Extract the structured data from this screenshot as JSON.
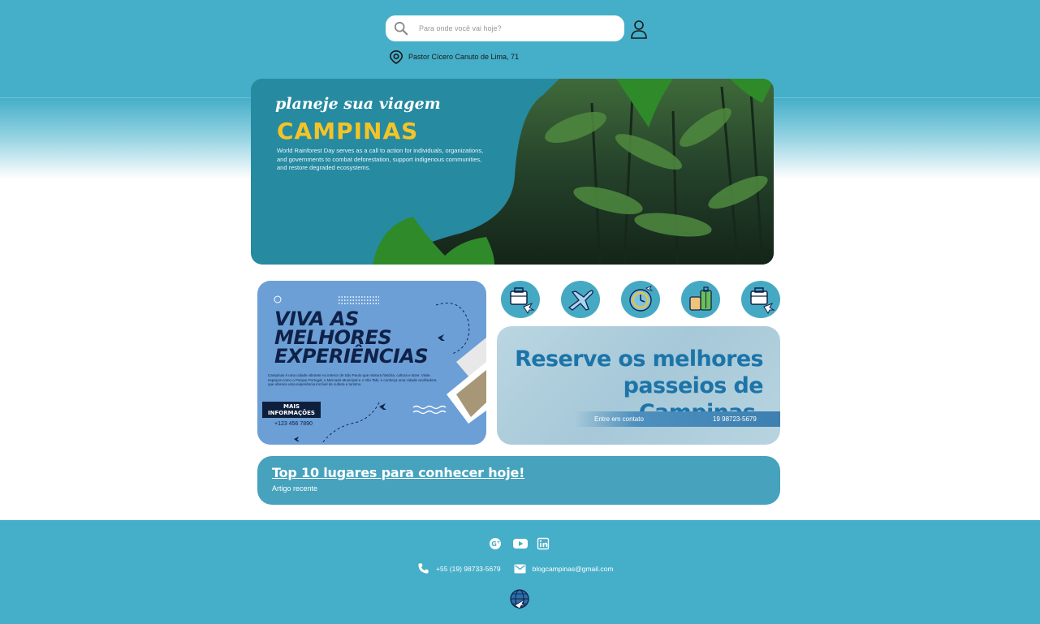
{
  "search": {
    "placeholder": "Para onde você vai hoje?"
  },
  "location": {
    "address": "Pastor Cícero Canuto de Lima, 71"
  },
  "hero": {
    "tagline": "planeje sua viagem",
    "title": "CAMPINAS",
    "description": "World Rainforest Day serves as a call to action for individuals, organizations, and governments to combat deforestation, support indigenous communities, and restore degraded ecosystems."
  },
  "promo": {
    "title_line1": "VIVA AS",
    "title_line2": "MELHORES",
    "title_line3": "EXPERIÊNCIAS",
    "text": "Campinas é uma cidade vibrante no interior de São Paulo que mistura história, cultura e lazer. Visite espaços como o Parque Portugal, o Mercado Municipal e o Vila Tabi, e conheça uma cidade acolhedora que oferece uma experiência incrível de cultura e turismo.",
    "button_line1": "MAIS",
    "button_line2": "INFORMAÇÕES",
    "phone": "+123 456 7890"
  },
  "categories": [
    {
      "icon": "luggage-plane-icon"
    },
    {
      "icon": "airplane-icon"
    },
    {
      "icon": "clock-compass-icon"
    },
    {
      "icon": "suitcases-icon"
    },
    {
      "icon": "luggage-plane-icon"
    }
  ],
  "reserve": {
    "title_line1": "Reserve os melhores",
    "title_line2": "passeios de Campinas.",
    "contact_label": "Entre em contato",
    "phone": "19 98723-5679"
  },
  "article": {
    "title": "Top 10 lugares para conhecer hoje!",
    "subtitle": "Artigo recente"
  },
  "footer": {
    "social": [
      "google-plus-icon",
      "youtube-icon",
      "linkedin-icon"
    ],
    "phone": "+55 (19) 98733-5679",
    "email": "blogcampinas@gmail.com"
  },
  "colors": {
    "header": "#45aec8",
    "hero": "#268aa1",
    "accent_yellow": "#f4c426",
    "promo": "#6c9fd6",
    "navy": "#0f2147",
    "reserve_title": "#1c74a8"
  }
}
